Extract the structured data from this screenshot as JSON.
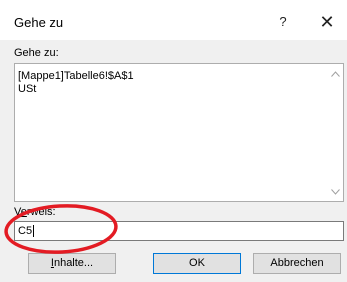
{
  "window": {
    "title": "Gehe zu",
    "help_glyph": "?",
    "close_glyph": "✕"
  },
  "goto": {
    "label": "Gehe zu:",
    "items": [
      "[Mappe1]Tabelle6!$A$1",
      "USt"
    ]
  },
  "scrollbar": {
    "up_icon": "chevron-up-icon",
    "down_icon": "chevron-down-icon"
  },
  "reference": {
    "label_accel": "e",
    "label_rest": "rweis:",
    "label_prefix": "V",
    "value": "C5"
  },
  "buttons": {
    "contents_accel": "I",
    "contents_rest": "nhalte...",
    "ok": "OK",
    "cancel": "Abbrechen"
  },
  "annotation": {
    "color": "#e31b23"
  }
}
